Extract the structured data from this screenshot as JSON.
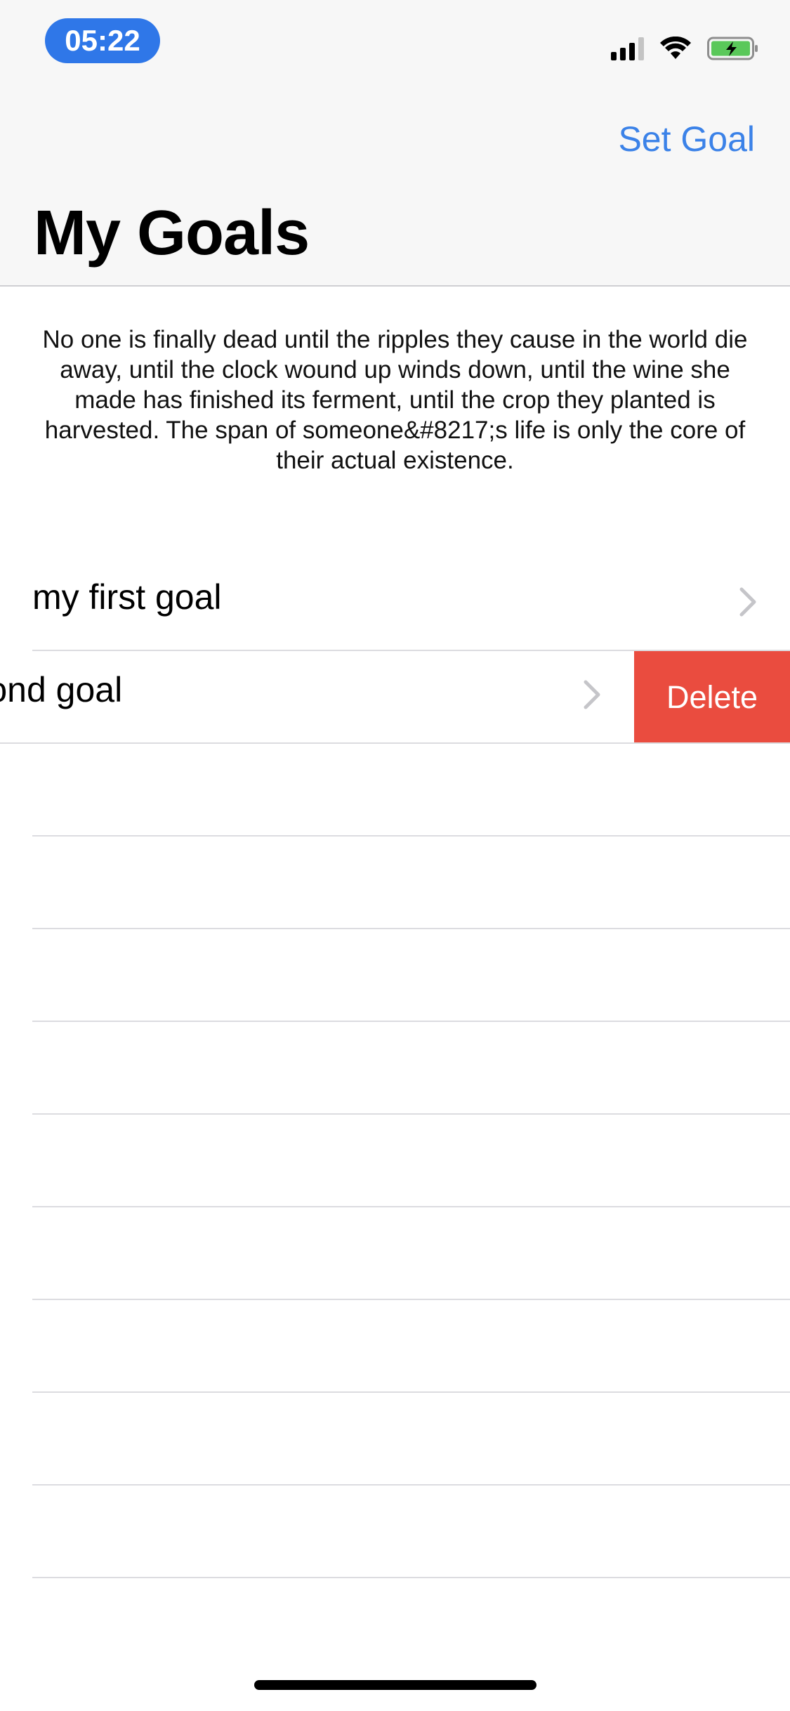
{
  "status_bar": {
    "time": "05:22",
    "signal_icon": "cellular-signal-icon",
    "wifi_icon": "wifi-icon",
    "battery_icon": "battery-charging-icon",
    "accent_color": "#2f77e8"
  },
  "nav": {
    "right_button": "Set Goal",
    "title": "My Goals",
    "tint_color": "#3b82e8"
  },
  "quote": {
    "text": "No one is finally dead until the ripples they cause in the world die away, until the clock wound up winds down, until the wine she made has finished its ferment, until the crop they planted is harvested. The span of someone&#8217;s life is only the core of their actual existence."
  },
  "goals": {
    "items": [
      {
        "label": "my first goal",
        "chevron_icon": "chevron-right-icon",
        "swiped": false
      },
      {
        "label": "my second goal",
        "chevron_icon": "chevron-right-icon",
        "swiped": true
      }
    ],
    "delete_label": "Delete",
    "delete_color": "#ea4c3f"
  }
}
